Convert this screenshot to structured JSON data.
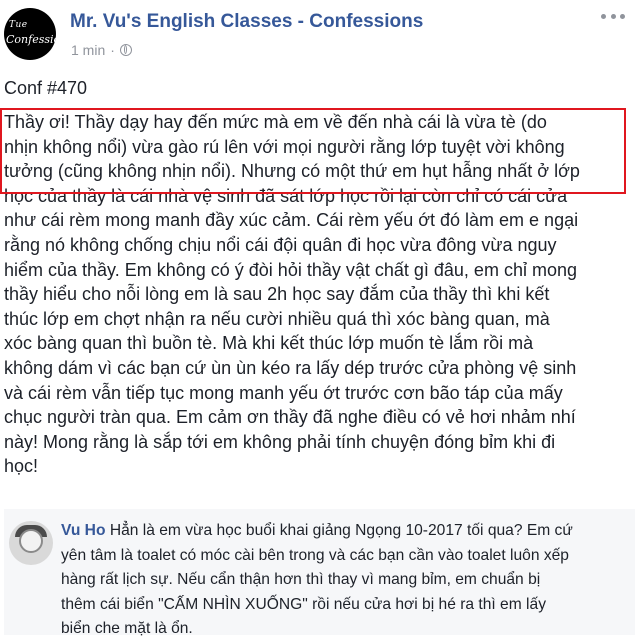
{
  "post": {
    "page_name": "Mr. Vu's English Classes - Confessions",
    "time": "1 min",
    "separator": "·",
    "avatar_text_line1": "Tue",
    "avatar_text_line2": "Confession",
    "conf_number": "Conf #470",
    "body": "Thầy ơi! Thầy dạy hay đến mức mà em về đến nhà cái là vừa tè (do\nnhịn không nổi) vừa gào rú lên với mọi người rằng lớp tuyệt vời không\ntưởng (cũng không nhịn nổi). Nhưng có một thứ em hụt hẫng nhất ở lớp\nhọc của thầy là cái nhà vệ sinh đã sát lớp học rồi lại còn chỉ có cái cửa\nnhư cái rèm mong manh đầy xúc cảm. Cái rèm yếu ớt đó làm em e ngại\nrằng nó không chống chịu nổi cái đội quân đi học vừa đông vừa nguy\nhiểm của thầy. Em không có ý đòi hỏi thầy vật chất gì đâu, em chỉ mong\nthầy hiểu cho nỗi lòng em là sau 2h học say đắm của thầy thì khi kết\nthúc lớp em chợt nhận ra nếu cười nhiều quá thì xóc bàng quan, mà\nxóc bàng quan thì buồn tè. Mà khi kết thúc lớp muốn tè lắm rồi mà\nkhông dám vì các bạn cứ ùn ùn kéo ra lấy dép trước cửa phòng vệ sinh\nvà cái rèm vẫn tiếp tục mong manh yếu ớt trước cơn bão táp của mấy\nchục người tràn qua. Em cảm ơn thầy đã nghe điều có vẻ hơi nhảm nhí\nnày! Mong rằng là sắp tới em không phải tính chuyện đóng bỉm khi đi\nhọc!"
  },
  "comment": {
    "author": "Vu Ho",
    "text": "Hẳn là em vừa học buổi khai giảng Ngọng 10-2017 tối qua? Em cứ\nyên tâm là toalet có móc cài bên trong và các bạn cần vào toalet luôn xếp\nhàng rất lịch sự. Nếu cẩn thận hơn thì thay vì mang bỉm, em chuẩn bị\nthêm cái biển \"CẤM NHÌN XUỐNG\" rồi nếu cửa hơi bị hé ra thì em lấy\nbiển che mặt là ổn."
  },
  "colors": {
    "link": "#365899",
    "highlight_border": "#e0171f",
    "meta": "#90949c",
    "comment_bg": "#f6f7f9"
  },
  "icons": [
    "globe-icon",
    "more-options-icon"
  ]
}
